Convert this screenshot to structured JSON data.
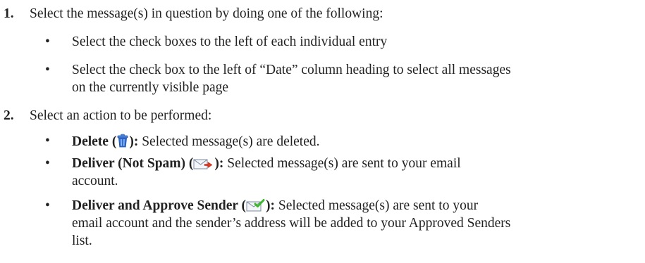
{
  "steps": [
    {
      "number": "1.",
      "text": "Select the message(s) in question by doing one of the following:",
      "bullets": [
        "Select the check boxes to the left of each individual entry",
        "Select the check box to the left of “Date” column heading to select all messages",
        "on the currently visible page"
      ]
    },
    {
      "number": "2.",
      "text": "Select an action to be performed:",
      "actions": [
        {
          "label_pre": "Delete (",
          "label_post": "):",
          "desc": " Selected message(s) are deleted.",
          "icon": "trash-can-icon"
        },
        {
          "label_pre": "Deliver (Not Spam) (",
          "label_post": "):",
          "desc": " Selected message(s) are sent to your email",
          "desc_cont": "account.",
          "icon": "envelope-red-arrow-icon"
        },
        {
          "label_pre": "Deliver and Approve Sender (",
          "label_post": "):",
          "desc": " Selected message(s) are sent to your",
          "desc_cont": "email account and the sender’s address will be added to your Approved Senders",
          "desc_cont2": "list.",
          "icon": "envelope-green-check-icon"
        }
      ]
    }
  ],
  "bullet_char": "•",
  "colors": {
    "text": "#222222",
    "trash_blue": "#2f6fd6",
    "arrow_red": "#e23a22",
    "check_green": "#3cb82c",
    "envelope_border": "#7a8aa0"
  }
}
